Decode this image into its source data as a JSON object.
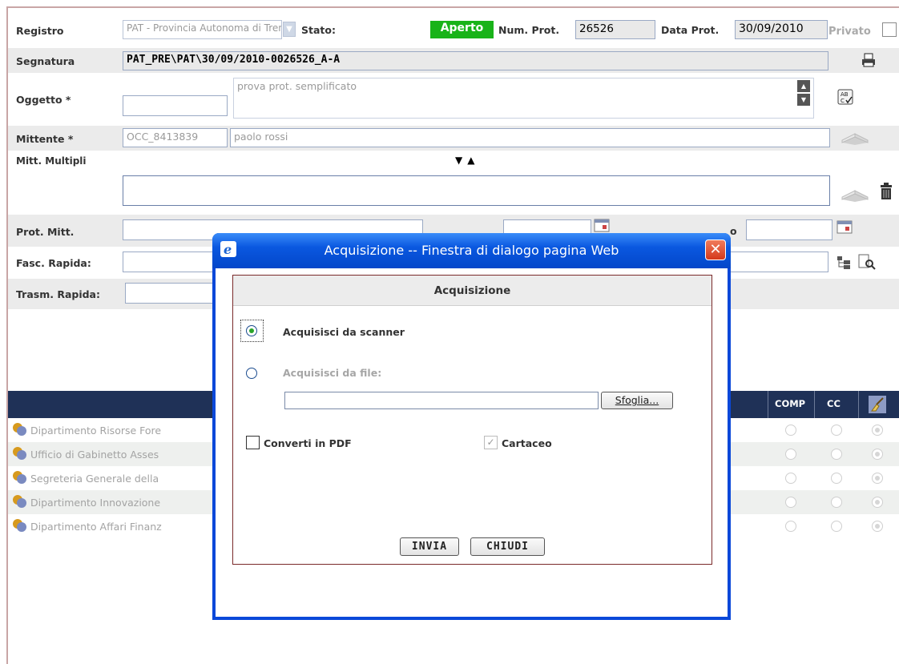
{
  "form": {
    "registro": {
      "label": "Registro",
      "value": "PAT - Provincia Autonoma di Tren"
    },
    "stato": {
      "label": "Stato:",
      "value": "Aperto"
    },
    "num_prot": {
      "label": "Num. Prot.",
      "value": "26526"
    },
    "data_prot": {
      "label": "Data Prot.",
      "value": "30/09/2010"
    },
    "privato": {
      "label": "Privato"
    },
    "segnatura": {
      "label": "Segnatura",
      "value": "PAT_PRE\\PAT\\30/09/2010-0026526_A-A"
    },
    "oggetto": {
      "label": "Oggetto *",
      "value": "prova prot. semplificato"
    },
    "mittente": {
      "label": "Mittente *",
      "code": "OCC_8413839",
      "name": "paolo rossi"
    },
    "mitt_multipli": {
      "label": "Mitt. Multipli"
    },
    "prot_mitt": {
      "label": "Prot. Mitt.",
      "data_label_partial": "o"
    },
    "fasc_rapida": {
      "label": "Fasc. Rapida:"
    },
    "trasm_rapida": {
      "label": "Trasm. Rapida:"
    }
  },
  "table": {
    "headers": {
      "comp": "COMP",
      "cc": "CC"
    },
    "rows": [
      {
        "name": "Dipartimento Risorse Fore"
      },
      {
        "name": "Ufficio di Gabinetto Asses"
      },
      {
        "name": "Segreteria Generale della"
      },
      {
        "name": "Dipartimento Innovazione"
      },
      {
        "name": "Dipartimento Affari Finanz"
      }
    ]
  },
  "dialog": {
    "title": "Acquisizione -- Finestra di dialogo pagina Web",
    "heading": "Acquisizione",
    "option_scanner": "Acquisisci da scanner",
    "option_file": "Acquisisci da file:",
    "browse_label": "Sfoglia...",
    "convert_pdf": "Converti in PDF",
    "cartaceo": "Cartaceo",
    "send_label": "INVIA",
    "close_label": "CHIUDI",
    "close_glyph": "✕"
  },
  "colors": {
    "status_green": "#19b319",
    "table_header": "#1f3157",
    "dialog_blue": "#0a48d9",
    "panel_border": "#7a2a2a"
  }
}
